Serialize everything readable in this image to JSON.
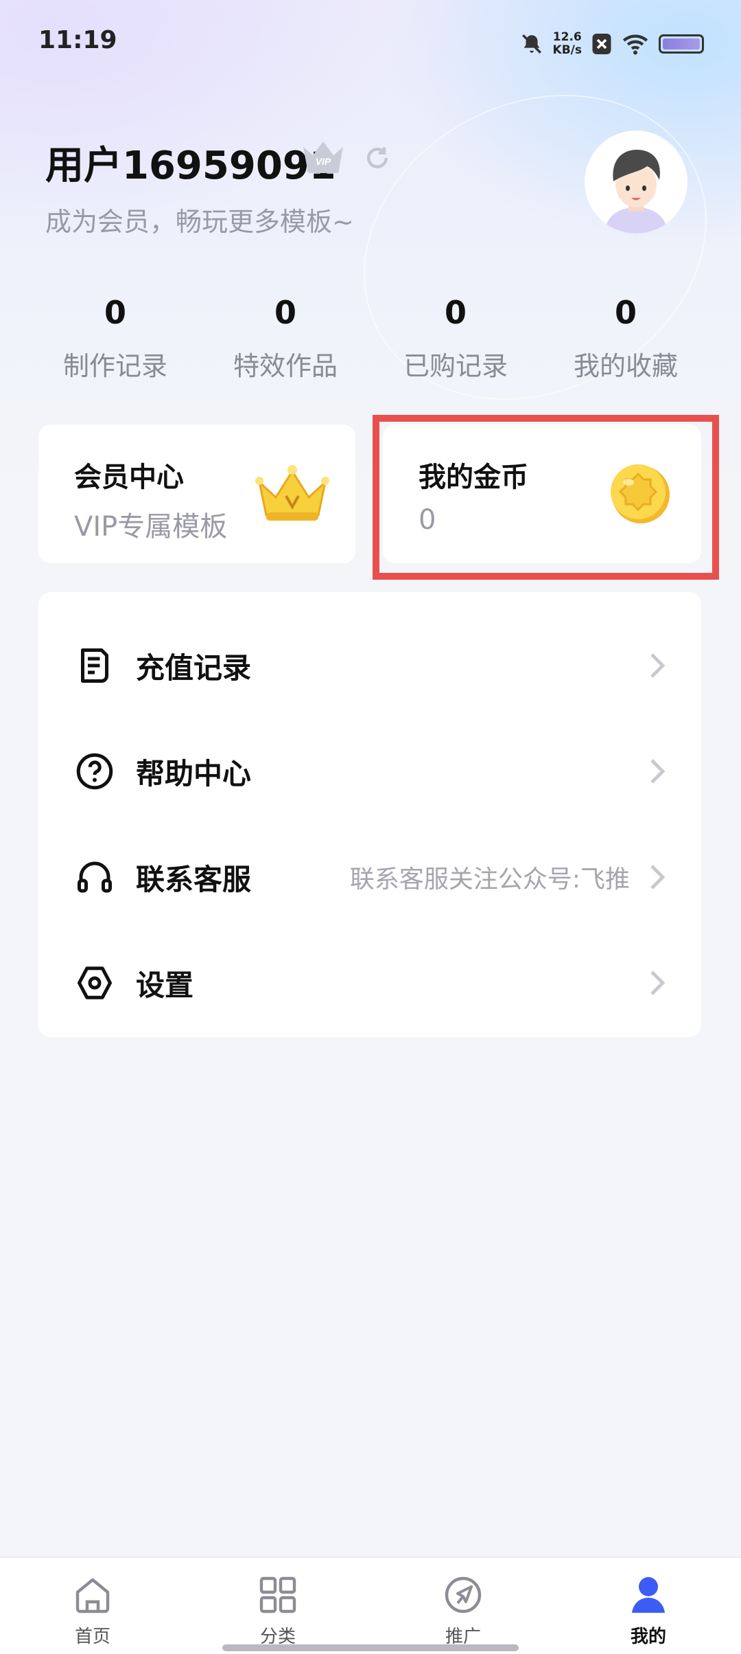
{
  "status_bar": {
    "time": "11:19",
    "net_speed_value": "12.6",
    "net_speed_unit": "KB/s",
    "icons": [
      "mute-bell-icon",
      "close-box-icon",
      "wifi-icon",
      "battery-icon"
    ]
  },
  "profile": {
    "username": "用户16959091",
    "vip_badge": "VIP",
    "subtitle": "成为会员，畅玩更多模板~"
  },
  "stats": [
    {
      "value": "0",
      "label": "制作记录"
    },
    {
      "value": "0",
      "label": "特效作品"
    },
    {
      "value": "0",
      "label": "已购记录"
    },
    {
      "value": "0",
      "label": "我的收藏"
    }
  ],
  "cards": {
    "vip": {
      "title": "会员中心",
      "subtitle": "VIP专属模板",
      "icon": "crown-icon"
    },
    "coins": {
      "title": "我的金币",
      "value": "0",
      "icon": "gold-coin-icon"
    }
  },
  "highlight_color": "#e9504d",
  "menu": [
    {
      "label": "充值记录",
      "extra": "",
      "icon": "receipt-icon"
    },
    {
      "label": "帮助中心",
      "extra": "",
      "icon": "help-circle-icon"
    },
    {
      "label": "联系客服",
      "extra": "联系客服关注公众号:飞推",
      "icon": "headset-icon"
    },
    {
      "label": "设置",
      "extra": "",
      "icon": "settings-hexagon-icon"
    }
  ],
  "bottom_nav": [
    {
      "label": "首页",
      "icon": "home-icon",
      "active": false
    },
    {
      "label": "分类",
      "icon": "grid-icon",
      "active": false
    },
    {
      "label": "推广",
      "icon": "compass-send-icon",
      "active": false
    },
    {
      "label": "我的",
      "icon": "user-icon",
      "active": true
    }
  ],
  "colors": {
    "accent": "#3d5cf5",
    "background": "#f4f5f8",
    "coin": "#f5c842"
  }
}
